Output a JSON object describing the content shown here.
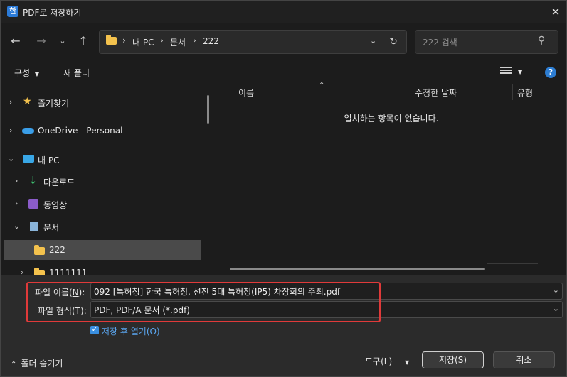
{
  "window": {
    "title": "PDF로 저장하기",
    "app_icon": "한"
  },
  "nav": {
    "breadcrumbs": [
      "내 PC",
      "문서",
      "222"
    ],
    "search_placeholder": "222 검색"
  },
  "toolbar": {
    "organize": "구성",
    "new_folder": "새 폴더"
  },
  "tree": [
    {
      "label": "즐겨찾기",
      "icon": "star-icon"
    },
    {
      "label": "OneDrive - Personal",
      "icon": "onedrive-icon"
    },
    {
      "label": "내 PC",
      "icon": "pc-icon"
    },
    {
      "label": "다운로드",
      "icon": "download-icon"
    },
    {
      "label": "동영상",
      "icon": "video-icon"
    },
    {
      "label": "문서",
      "icon": "documents-icon"
    },
    {
      "label": "222",
      "icon": "folder-icon",
      "selected": true
    },
    {
      "label": "1111111",
      "icon": "folder-icon"
    }
  ],
  "columns": {
    "name": "이름",
    "modified": "수정한 날짜",
    "type": "유형"
  },
  "empty_message": "일치하는 항목이 없습니다.",
  "form": {
    "filename_label": "파일 이름(",
    "filename_key": "N",
    "filename_value": "092 [특허청] 한국 특허청, 선진 5대 특허청(IP5) 차장회의 주최.pdf",
    "filetype_label": "파일 형식(",
    "filetype_key": "T",
    "filetype_value": "PDF, PDF/A 문서 (*.pdf)",
    "open_after_save": "저장 후 열기(O)"
  },
  "footer": {
    "hide_folders": "폴더 숨기기",
    "tools": "도구(L)",
    "save": "저장(S)",
    "cancel": "취소"
  },
  "colors": {
    "accent": "#2d7dd2",
    "highlight_border": "#e03a3a",
    "folder": "#f4c24d"
  }
}
